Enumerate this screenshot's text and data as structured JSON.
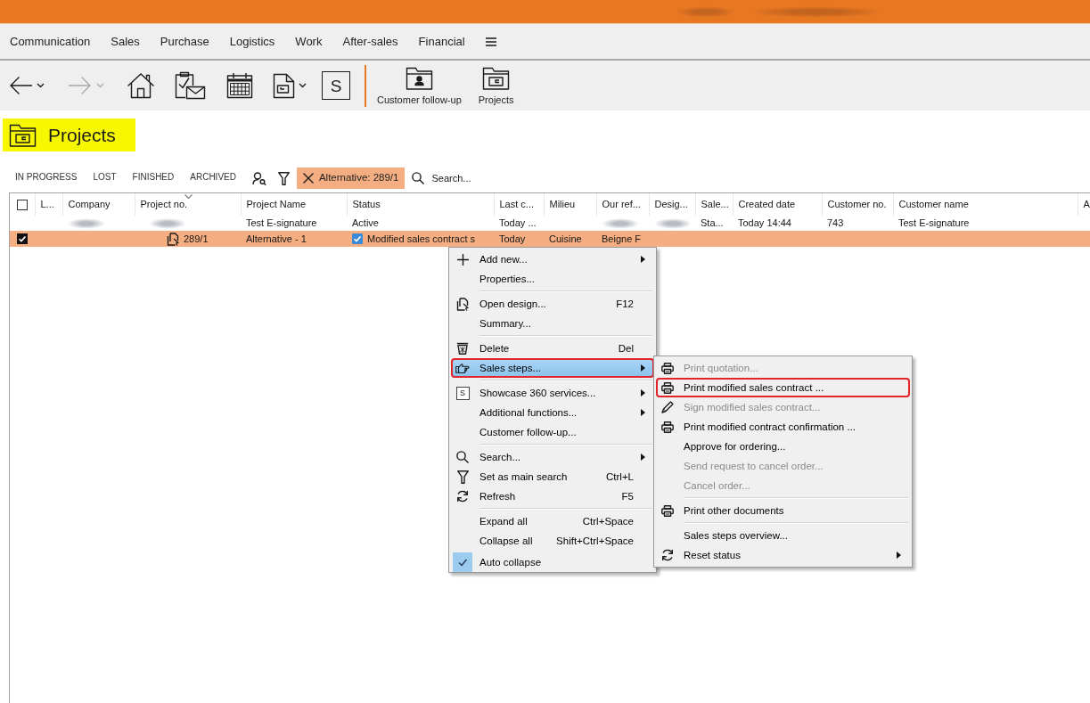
{
  "menu_bar": {
    "items": [
      "Communication",
      "Sales",
      "Purchase",
      "Logistics",
      "Work",
      "After-sales",
      "Financial"
    ]
  },
  "toolbar": {
    "history": [
      {
        "disabled": false
      },
      {
        "disabled": true
      }
    ],
    "s_button": "S",
    "shortcuts": [
      {
        "label": "Customer follow-up"
      },
      {
        "label": "Projects"
      }
    ]
  },
  "page_title": {
    "text": "Projects",
    "highlighted": true
  },
  "filter_bar": {
    "tabs": [
      {
        "label": "IN PROGRESS",
        "selected": false
      },
      {
        "label": "LOST",
        "selected": false
      },
      {
        "label": "FINISHED",
        "selected": false
      },
      {
        "label": "ARCHIVED",
        "selected": false
      }
    ],
    "active_filter": "Alternative: 289/1",
    "search": {
      "placeholder": "Search..."
    }
  },
  "table": {
    "header_checked": false,
    "columns": [
      {
        "label": "L...",
        "sorted": false
      },
      {
        "label": "Company",
        "sorted": false
      },
      {
        "label": "Project no.",
        "sorted": true
      },
      {
        "label": "Project Name",
        "sorted": false
      },
      {
        "label": "Status",
        "sorted": false
      },
      {
        "label": "Last c...",
        "sorted": false
      },
      {
        "label": "Milieu",
        "sorted": false
      },
      {
        "label": "Our ref...",
        "sorted": false
      },
      {
        "label": "Desig...",
        "sorted": false
      },
      {
        "label": "Sale...",
        "sorted": false
      },
      {
        "label": "Created date",
        "sorted": false
      },
      {
        "label": "Customer no.",
        "sorted": false
      },
      {
        "label": "Customer name",
        "sorted": false
      },
      {
        "label": "A",
        "sorted": false
      }
    ],
    "rows": [
      {
        "selected": false,
        "cells": [
          null,
          {
            "kind": "redacted"
          },
          {
            "kind": "redacted"
          },
          {
            "kind": "text",
            "text": "Test E-signature"
          },
          {
            "kind": "text",
            "text": "Active"
          },
          {
            "kind": "text",
            "text": "Today ..."
          },
          null,
          {
            "kind": "redacted"
          },
          {
            "kind": "redacted"
          },
          {
            "kind": "text",
            "text": "Sta..."
          },
          {
            "kind": "text",
            "text": "Today 14:44"
          },
          {
            "kind": "text",
            "text": "743"
          },
          {
            "kind": "text",
            "text": "Test E-signature"
          }
        ],
        "children": [
          {
            "selected": true,
            "checked": true,
            "cells": [
              null,
              null,
              {
                "kind": "document",
                "text": "289/1"
              },
              {
                "kind": "text",
                "text": "Alternative - 1"
              },
              {
                "kind": "check",
                "checked": true,
                "text": "Modified sales contract s"
              },
              {
                "kind": "text",
                "text": "Today"
              },
              {
                "kind": "text",
                "text": "Cuisine"
              },
              {
                "kind": "text",
                "text": "Beigne F"
              }
            ]
          }
        ]
      }
    ]
  },
  "context_menu": {
    "sections": [
      [
        {
          "label": "Add new...",
          "has_submenu": true,
          "selected": false,
          "outlined": false,
          "checked": false
        },
        {
          "label": "Properties...",
          "has_submenu": false,
          "selected": false,
          "outlined": false,
          "checked": false
        }
      ],
      [
        {
          "label": "Open design...",
          "shortcut": "F12",
          "has_submenu": false,
          "selected": false,
          "outlined": false,
          "checked": false
        },
        {
          "label": "Summary...",
          "has_submenu": false,
          "selected": false,
          "outlined": false,
          "checked": false
        }
      ],
      [
        {
          "label": "Delete",
          "shortcut": "Del",
          "has_submenu": false,
          "selected": false,
          "outlined": false,
          "checked": false
        },
        {
          "label": "Sales steps...",
          "has_submenu": true,
          "selected": true,
          "outlined": true,
          "checked": false
        }
      ],
      [
        {
          "label": "Showcase 360 services...",
          "icon_text": "S",
          "has_submenu": true,
          "selected": false,
          "outlined": false,
          "checked": false
        },
        {
          "label": "Additional functions...",
          "has_submenu": true,
          "selected": false,
          "outlined": false,
          "checked": false
        },
        {
          "label": "Customer follow-up...",
          "has_submenu": false,
          "selected": false,
          "outlined": false,
          "checked": false
        }
      ],
      [
        {
          "label": "Search...",
          "has_submenu": true,
          "selected": false,
          "outlined": false,
          "checked": false
        },
        {
          "label": "Set as main search",
          "shortcut": "Ctrl+L",
          "has_submenu": false,
          "selected": false,
          "outlined": false,
          "checked": false
        },
        {
          "label": "Refresh",
          "shortcut": "F5",
          "has_submenu": false,
          "selected": false,
          "outlined": false,
          "checked": false
        }
      ],
      [
        {
          "label": "Expand all",
          "shortcut": "Ctrl+Space",
          "has_submenu": false,
          "selected": false,
          "outlined": false,
          "checked": false
        },
        {
          "label": "Collapse all",
          "shortcut": "Shift+Ctrl+Space",
          "has_submenu": false,
          "selected": false,
          "outlined": false,
          "checked": false
        },
        {
          "label": "Auto collapse",
          "has_submenu": false,
          "selected": false,
          "outlined": false,
          "checked": true
        }
      ]
    ]
  },
  "submenu": {
    "sections": [
      [
        {
          "label": "Print quotation...",
          "disabled": true,
          "has_submenu": false,
          "outlined": false
        },
        {
          "label": "Print modified sales contract ...",
          "disabled": false,
          "has_submenu": false,
          "outlined": true
        },
        {
          "label": "Sign modified sales contract...",
          "disabled": true,
          "has_submenu": false,
          "outlined": false
        },
        {
          "label": "Print modified contract confirmation ...",
          "disabled": false,
          "has_submenu": false,
          "outlined": false
        },
        {
          "label": "Approve for ordering...",
          "disabled": false,
          "has_submenu": false,
          "outlined": false
        },
        {
          "label": "Send request to cancel order...",
          "disabled": true,
          "has_submenu": false,
          "outlined": false
        },
        {
          "label": "Cancel order...",
          "disabled": true,
          "has_submenu": false,
          "outlined": false
        }
      ],
      [
        {
          "label": "Print other documents",
          "disabled": false,
          "has_submenu": false,
          "outlined": false
        }
      ],
      [
        {
          "label": "Sales steps overview...",
          "disabled": false,
          "has_submenu": false,
          "outlined": false
        },
        {
          "label": "Reset status",
          "disabled": false,
          "has_submenu": true,
          "outlined": false
        }
      ]
    ]
  }
}
